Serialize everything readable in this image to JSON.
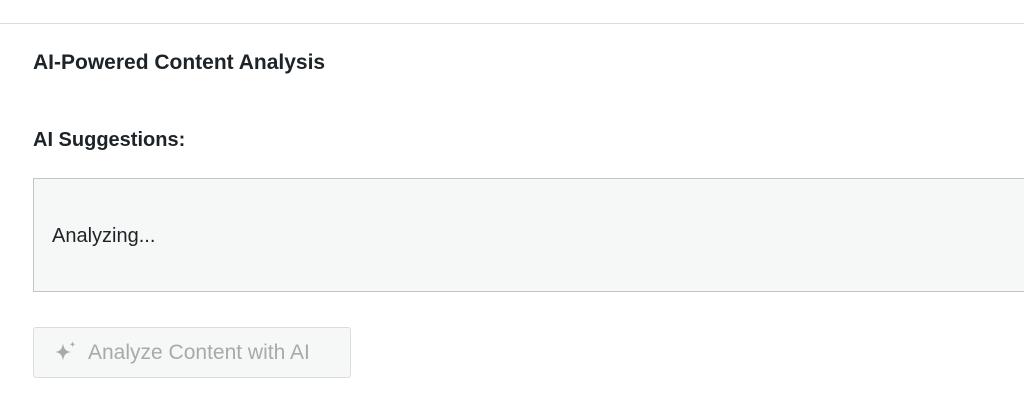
{
  "panel": {
    "title": "AI-Powered Content Analysis"
  },
  "suggestions": {
    "label": "AI Suggestions:",
    "content": "Analyzing..."
  },
  "analyze_button": {
    "label": "Analyze Content with AI",
    "icon": "sparkle-icon",
    "state": "disabled"
  },
  "colors": {
    "text": "#1d2327",
    "disabled_text": "#a7aaad",
    "box_background": "#f6f7f7",
    "border": "#c3c4c7",
    "divider": "#dcdcde"
  }
}
